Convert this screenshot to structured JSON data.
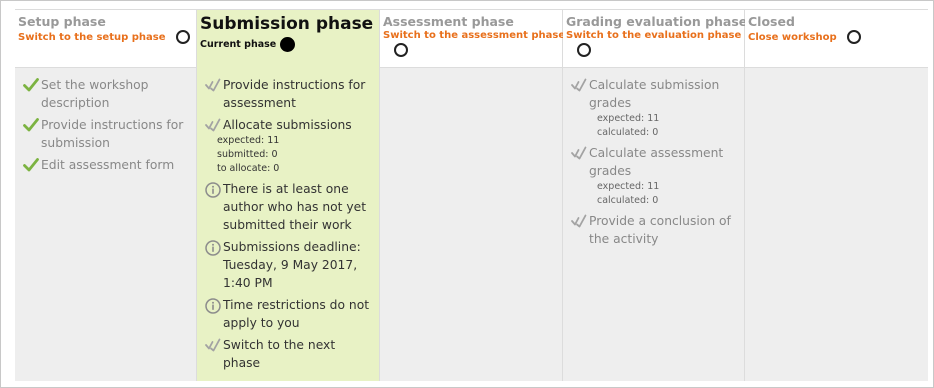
{
  "colors": {
    "link": "#e8701c",
    "done_check": "#7cb342",
    "current_bg": "#e8f2c5",
    "inactive_bg": "#eeeeee"
  },
  "phases": [
    {
      "title": "Setup phase",
      "action": "Switch to the setup phase",
      "tasks": [
        {
          "icon": "green-check-icon",
          "label": "Set the workshop description"
        },
        {
          "icon": "green-check-icon",
          "label": "Provide instructions for submission"
        },
        {
          "icon": "green-check-icon",
          "label": "Edit assessment form"
        }
      ]
    },
    {
      "title": "Submission phase",
      "current_label": "Current phase",
      "tasks": [
        {
          "icon": "todo-check-icon",
          "label": "Provide instructions for assessment"
        },
        {
          "icon": "todo-check-icon",
          "label": "Allocate submissions",
          "details": [
            "expected: 11",
            "submitted: 0",
            "to allocate: 0"
          ]
        },
        {
          "icon": "info-icon",
          "label": "There is at least one author who has not yet submitted their work"
        },
        {
          "icon": "info-icon",
          "label": "Submissions deadline: Tuesday, 9 May 2017, 1:40 PM"
        },
        {
          "icon": "info-icon",
          "label": "Time restrictions do not apply to you"
        },
        {
          "icon": "todo-check-icon",
          "label": "Switch to the next phase"
        }
      ]
    },
    {
      "title": "Assessment phase",
      "action": "Switch to the assessment phase"
    },
    {
      "title": "Grading evaluation phase",
      "action": "Switch to the evaluation phase",
      "tasks": [
        {
          "icon": "todo-check-icon",
          "label": "Calculate submission grades",
          "details": [
            "expected: 11",
            "calculated: 0"
          ]
        },
        {
          "icon": "todo-check-icon",
          "label": "Calculate assessment grades",
          "details": [
            "expected: 11",
            "calculated: 0"
          ]
        },
        {
          "icon": "todo-check-icon",
          "label": "Provide a conclusion of the activity"
        }
      ]
    },
    {
      "title": "Closed",
      "action": "Close workshop"
    }
  ]
}
